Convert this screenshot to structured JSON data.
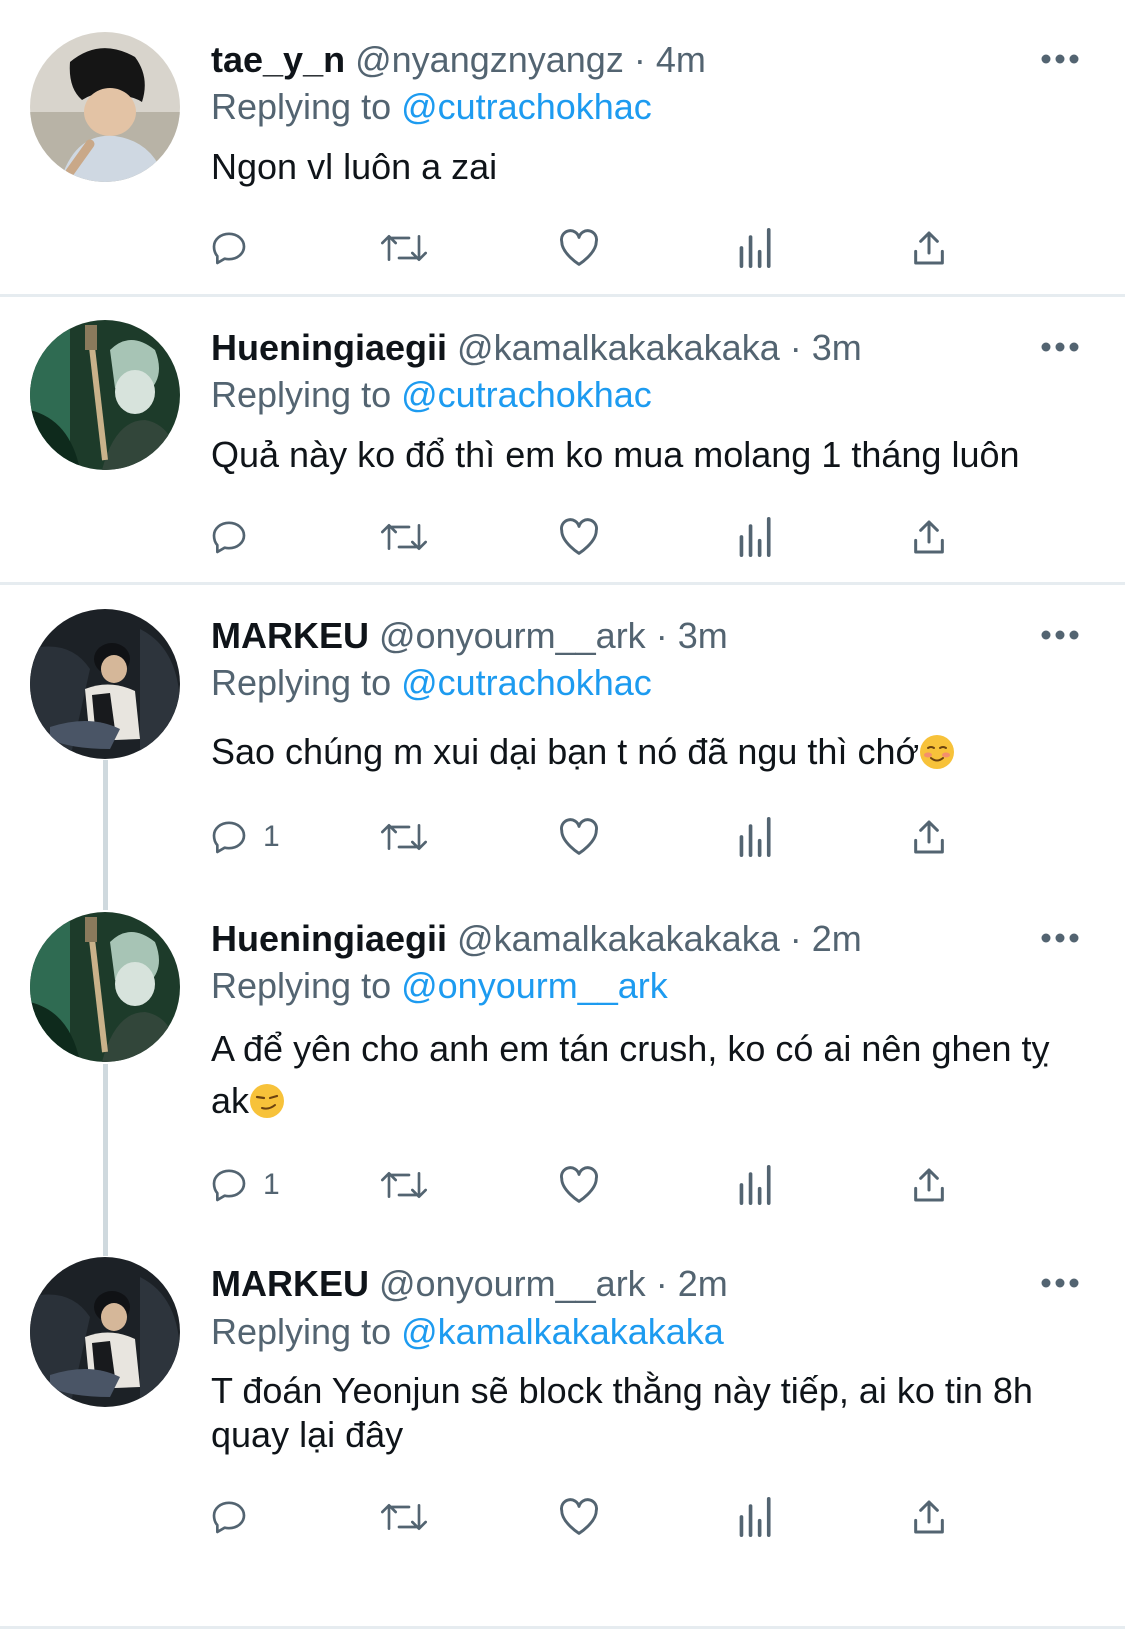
{
  "tweets": [
    {
      "name": "tae_y_n",
      "handle": "@nyangznyangz",
      "separator": "·",
      "time": "4m",
      "replying_prefix": "Replying to ",
      "replying_to": "@cutrachokhac",
      "text": "Ngon vl luôn a zai",
      "emoji": "",
      "reply_count": ""
    },
    {
      "name": "Hueningiaegii",
      "handle": "@kamalkakakakaka",
      "separator": "·",
      "time": "3m",
      "replying_prefix": "Replying to ",
      "replying_to": "@cutrachokhac",
      "text": "Quả này ko đổ thì em ko mua molang 1 tháng luôn",
      "emoji": "",
      "reply_count": ""
    },
    {
      "name": "MARKEU",
      "handle": "@onyourm__ark",
      "separator": "·",
      "time": "3m",
      "replying_prefix": "Replying to ",
      "replying_to": "@cutrachokhac",
      "text": "Sao chúng m xui dại bạn t nó đã ngu thì chớ",
      "emoji": "☺️",
      "reply_count": "1"
    },
    {
      "name": "Hueningiaegii",
      "handle": "@kamalkakakakaka",
      "separator": "·",
      "time": "2m",
      "replying_prefix": "Replying to ",
      "replying_to": "@onyourm__ark",
      "text": "A để yên cho anh em tán crush, ko có ai nên ghen tỵ ak",
      "emoji": "😏",
      "reply_count": "1"
    },
    {
      "name": "MARKEU",
      "handle": "@onyourm__ark",
      "separator": "·",
      "time": "2m",
      "replying_prefix": "Replying to ",
      "replying_to": "@kamalkakakakaka",
      "text": "T đoán Yeonjun sẽ block thằng này tiếp, ai ko tin 8h quay lại đây",
      "emoji": "",
      "reply_count": ""
    }
  ],
  "icons": {
    "reply": "reply-icon",
    "retweet": "retweet-icon",
    "like": "heart-icon",
    "views": "analytics-icon",
    "share": "share-icon",
    "more": "more-icon"
  },
  "colors": {
    "link": "#1d9bf0",
    "secondary_text": "#536471",
    "primary_text": "#0f1419",
    "icon": "#536471",
    "divider": "#e6ecf0",
    "thread_line": "#cfd9de"
  }
}
